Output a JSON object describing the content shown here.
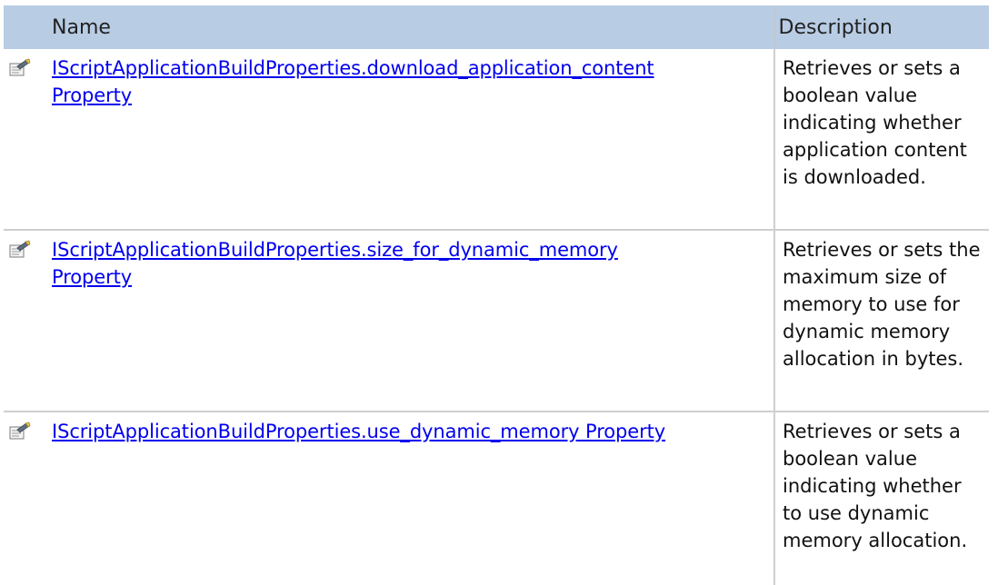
{
  "table": {
    "headers": {
      "name": "Name",
      "description": "Description"
    },
    "rows": [
      {
        "icon": "property-icon",
        "name_line1": "IScriptApplicationBuildProperties.download_application_content",
        "name_line2": "Property",
        "description": "Retrieves or sets a boolean value indicating whether application content is downloaded."
      },
      {
        "icon": "property-icon",
        "name_line1": "IScriptApplicationBuildProperties.size_for_dynamic_memory",
        "name_line2": "Property",
        "description": "Retrieves or sets the maximum size of memory to use for dynamic memory allocation in bytes."
      },
      {
        "icon": "property-icon",
        "name_line1": "IScriptApplicationBuildProperties.use_dynamic_memory Property",
        "name_line2": "",
        "description": "Retrieves or sets a boolean value indicating whether to use dynamic memory allocation."
      }
    ]
  },
  "colors": {
    "header_bg": "#b8cce4",
    "link": "#0000ee",
    "grid": "#cfcfcf"
  }
}
